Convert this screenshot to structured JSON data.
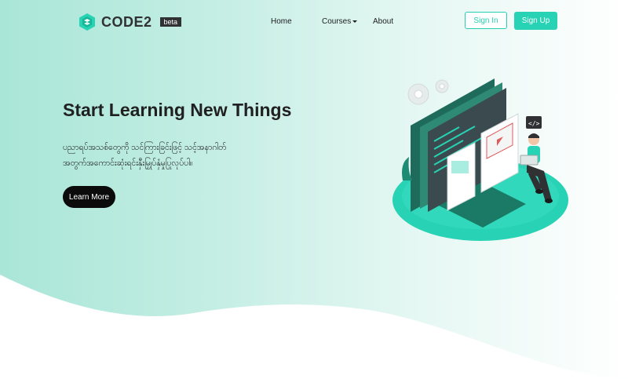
{
  "brand": {
    "name": "CODE2",
    "badge": "beta",
    "icon": "hexagon-logo-icon"
  },
  "nav": {
    "links": [
      {
        "label": "Home"
      },
      {
        "label": "Courses",
        "has_caret": true
      },
      {
        "label": "About"
      }
    ],
    "sign_in": "Sign In",
    "sign_up": "Sign Up"
  },
  "hero": {
    "title": "Start Learning New Things",
    "description_lines": [
      "ပညာရပ်အသစ်တွေကို သင်ကြားခြင်းဖြင့် သင့်အနာဂါတ်",
      "အတွက်အကောင်းဆုံးရင်းနှီးမြှုပ်နှံမှုပြုလုပ်ပါ။"
    ],
    "cta": "Learn More"
  },
  "colors": {
    "accent": "#27d3b4",
    "dark": "#0b0b0b",
    "hero_bg": "#bfece1"
  }
}
